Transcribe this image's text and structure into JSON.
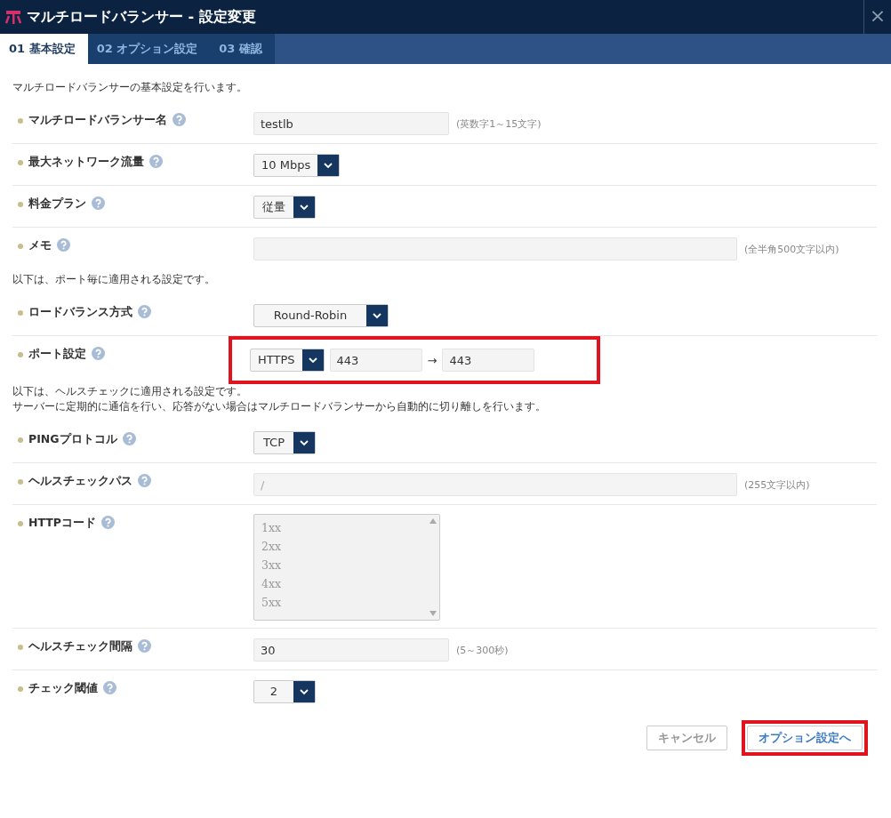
{
  "window": {
    "title": "マルチロードバランサー - 設定変更",
    "close": "×"
  },
  "tabs": [
    {
      "label": "01 基本設定",
      "selected": true
    },
    {
      "label": "02 オプション設定",
      "selected": false
    },
    {
      "label": "03 確認",
      "selected": false
    }
  ],
  "sections": [
    {
      "intro": [
        "マルチロードバランサーの基本設定を行います。"
      ],
      "rows": [
        {
          "label": "マルチロードバランサー名",
          "kind": "text",
          "value": "testlb",
          "hint": "(英数字1～15文字)",
          "disabled": false
        },
        {
          "label": "最大ネットワーク流量",
          "kind": "select",
          "value": "10 Mbps"
        },
        {
          "label": "料金プラン",
          "kind": "select",
          "value": "従量"
        },
        {
          "label": "メモ",
          "kind": "wide-text",
          "value": "",
          "hint": "(全半角500文字以内)"
        }
      ]
    },
    {
      "intro": [
        "以下は、ポート毎に適用される設定です。"
      ],
      "rows": [
        {
          "label": "ロードバランス方式",
          "kind": "select",
          "value": "Round-Robin"
        },
        {
          "label": "ポート設定",
          "kind": "port",
          "protocol": "HTTPS",
          "from": "443",
          "arrow": "→",
          "to": "443",
          "highlighted": true
        }
      ]
    },
    {
      "intro": [
        "以下は、ヘルスチェックに適用される設定です。",
        "サーバーに定期的に通信を行い、応答がない場合はマルチロードバランサーから自動的に切り離しを行います。"
      ],
      "rows": [
        {
          "label": "PINGプロトコル",
          "kind": "select",
          "value": "TCP"
        },
        {
          "label": "ヘルスチェックパス",
          "kind": "wide-text",
          "placeholder": "/",
          "hint": "(255文字以内)"
        },
        {
          "label": "HTTPコード",
          "kind": "list",
          "options": [
            "1xx",
            "2xx",
            "3xx",
            "4xx",
            "5xx"
          ],
          "disabled": true
        },
        {
          "label": "ヘルスチェック間隔",
          "kind": "text",
          "value": "30",
          "hint": "(5～300秒)",
          "disabled": false
        },
        {
          "label": "チェック閾値",
          "kind": "select",
          "value": "2"
        }
      ]
    }
  ],
  "buttons": [
    {
      "label": "キャンセル",
      "kind": "cancel",
      "highlighted": false
    },
    {
      "label": "オプション設定へ",
      "kind": "next",
      "highlighted": true
    }
  ]
}
